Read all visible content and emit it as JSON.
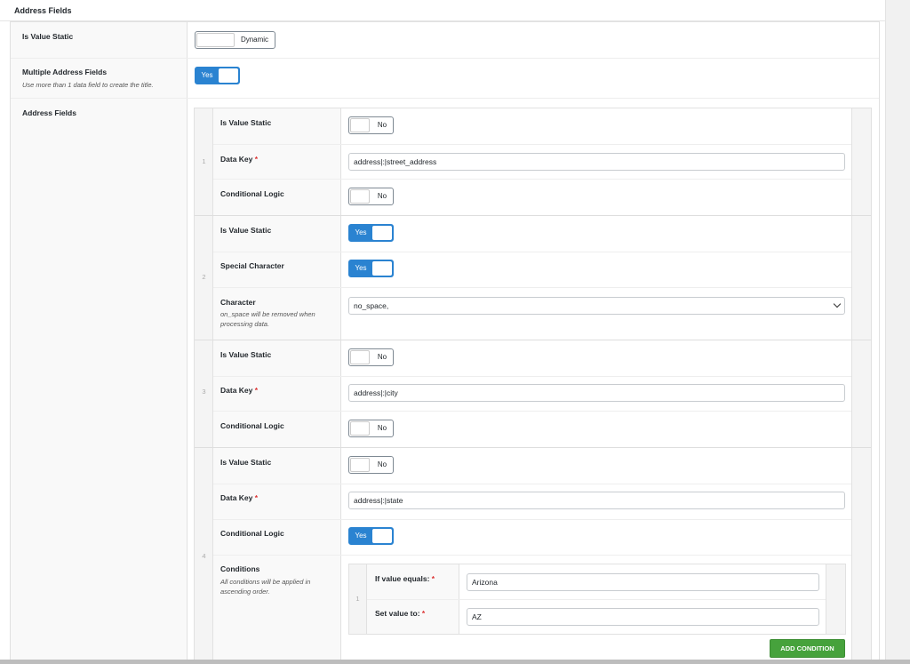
{
  "panel_title": "Address Fields",
  "fields": {
    "static": {
      "label": "Is Value Static",
      "toggle": "Dynamic"
    },
    "multiple": {
      "label": "Multiple Address Fields",
      "desc": "Use more than 1 data field to create the title.",
      "toggle": "Yes"
    },
    "address_fields": {
      "label": "Address Fields"
    }
  },
  "repeater": {
    "rows": [
      {
        "index": "1",
        "static_label": "Is Value Static",
        "static_toggle": "No",
        "key_label": "Data Key",
        "key_value": "address|:|street_address",
        "logic_label": "Conditional Logic",
        "logic_toggle": "No"
      },
      {
        "index": "2",
        "static_label": "Is Value Static",
        "static_toggle": "Yes",
        "special_label": "Special Character",
        "special_toggle": "Yes",
        "char_label": "Character",
        "char_desc": "on_space will be removed when processing data.",
        "char_value": "no_space,"
      },
      {
        "index": "3",
        "static_label": "Is Value Static",
        "static_toggle": "No",
        "key_label": "Data Key",
        "key_value": "address|:|city",
        "logic_label": "Conditional Logic",
        "logic_toggle": "No"
      },
      {
        "index": "4",
        "static_label": "Is Value Static",
        "static_toggle": "No",
        "key_label": "Data Key",
        "key_value": "address|:|state",
        "logic_label": "Conditional Logic",
        "logic_toggle": "Yes",
        "cond_label": "Conditions",
        "cond_desc": "All conditions will be applied in ascending order."
      }
    ],
    "required_mark": "*"
  },
  "conditions": {
    "index": "1",
    "if_label": "If value equals:",
    "if_value": "Arizona",
    "set_label": "Set value to:",
    "set_value": "AZ",
    "add_button": "ADD CONDITION"
  },
  "colors": {
    "toggle_on": "#2a83d1",
    "button_green": "#46a23c",
    "required": "#dc3232"
  }
}
